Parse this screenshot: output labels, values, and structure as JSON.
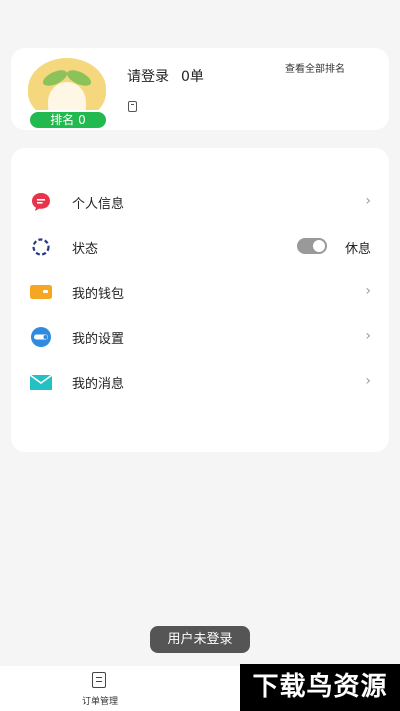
{
  "profile": {
    "login_prompt": "请登录",
    "order_count": "0单",
    "rank_label": "排名 0",
    "view_all_ranking": "查看全部排名"
  },
  "menu": {
    "items": [
      {
        "label": "个人信息",
        "icon": "message-icon",
        "color": "#e8334a"
      },
      {
        "label": "状态",
        "icon": "status-ring-icon",
        "color": "#1f3a8a"
      },
      {
        "label": "我的钱包",
        "icon": "wallet-icon",
        "color": "#f5a623"
      },
      {
        "label": "我的设置",
        "icon": "settings-toggle-icon",
        "color": "#2f8ae0"
      },
      {
        "label": "我的消息",
        "icon": "mail-icon",
        "color": "#22c1c3"
      }
    ],
    "status_value": "休息"
  },
  "toast": {
    "message": "用户未登录"
  },
  "bottom_nav": {
    "items": [
      {
        "label": "订单管理",
        "icon": "clipboard-icon"
      }
    ]
  },
  "watermark": {
    "text": "下载鸟资源"
  }
}
